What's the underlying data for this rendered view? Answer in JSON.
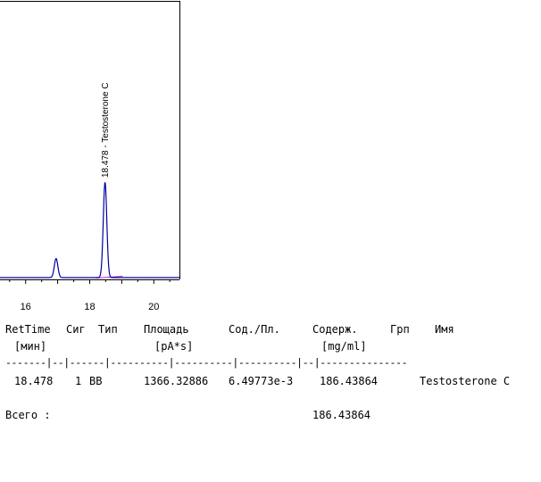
{
  "chart_data": {
    "type": "line",
    "xlim": [
      15.2,
      20.8
    ],
    "x_ticks": [
      16,
      18,
      20
    ],
    "x_tick_labels": [
      "16",
      "18",
      "20"
    ],
    "peaks": [
      {
        "rt": 16.95,
        "height_fraction": 0.2
      },
      {
        "rt": 18.478,
        "height_fraction": 1.0,
        "label": "18.478 -  Testosterone C"
      }
    ],
    "line_color": "#0000a0",
    "baseline_color": "#c020c0"
  },
  "report": {
    "header1": {
      "rettime": "RetTime",
      "sig": "Сиг",
      "type": "Тип",
      "area": "Площадь",
      "ratio": "Сод./Пл.",
      "amount": "Содерж.",
      "grp": "Грп",
      "name": "Имя"
    },
    "header2": {
      "rettime_unit": "[мин]",
      "area_unit": "[pA*s]",
      "amount_unit": "[mg/ml]"
    },
    "separator": "-------|--|------|----------|----------|----------|--|---------------",
    "rows": [
      {
        "rettime": "18.478",
        "sig": "1",
        "type": "BB",
        "area": "1366.32886",
        "ratio": "6.49773e-3",
        "amount": "186.43864",
        "grp": "",
        "name": "Testosterone C"
      }
    ],
    "total": {
      "label": "Всего :",
      "amount": "186.43864"
    }
  }
}
